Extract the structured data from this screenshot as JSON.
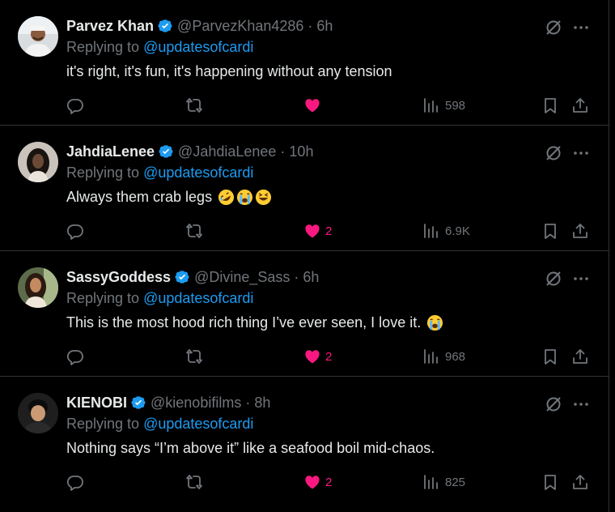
{
  "tweets": [
    {
      "name": "Parvez Khan",
      "handle": "@ParvezKhan4286",
      "dot": "·",
      "time": "6h",
      "replying_prefix": "Replying to ",
      "replying_to": "@updatesofcardi",
      "text": "it's right, it's fun, it's happening without any tension",
      "emojis": [],
      "likes": "",
      "liked": true,
      "views": "598"
    },
    {
      "name": "JahdiaLenee",
      "handle": "@JahdiaLenee",
      "dot": "·",
      "time": "10h",
      "replying_prefix": "Replying to ",
      "replying_to": "@updatesofcardi",
      "text": "Always them crab legs ",
      "emojis": [
        "rolling-laughing-emoji",
        "loudly-crying-emoji",
        "grinning-squinting-emoji"
      ],
      "likes": "2",
      "liked": true,
      "views": "6.9K"
    },
    {
      "name": "SassyGoddess",
      "handle": "@Divine_Sass",
      "dot": "·",
      "time": "6h",
      "replying_prefix": "Replying to ",
      "replying_to": "@updatesofcardi",
      "text": "This is the most hood rich thing I’ve ever seen, I love it. ",
      "emojis": [
        "loudly-crying-emoji"
      ],
      "likes": "2",
      "liked": true,
      "views": "968"
    },
    {
      "name": "KIENOBI",
      "handle": "@kienobifilms",
      "dot": "·",
      "time": "8h",
      "replying_prefix": "Replying to ",
      "replying_to": "@updatesofcardi",
      "text": "Nothing says “I’m above it” like a seafood boil mid-chaos.",
      "emojis": [],
      "likes": "2",
      "liked": true,
      "views": "825"
    }
  ],
  "colors": {
    "background": "#000000",
    "text": "#e7e9ea",
    "muted": "#71767b",
    "link": "#1d9bf0",
    "like": "#f91880",
    "verified": "#1d9bf0",
    "divider": "#2f3336"
  }
}
